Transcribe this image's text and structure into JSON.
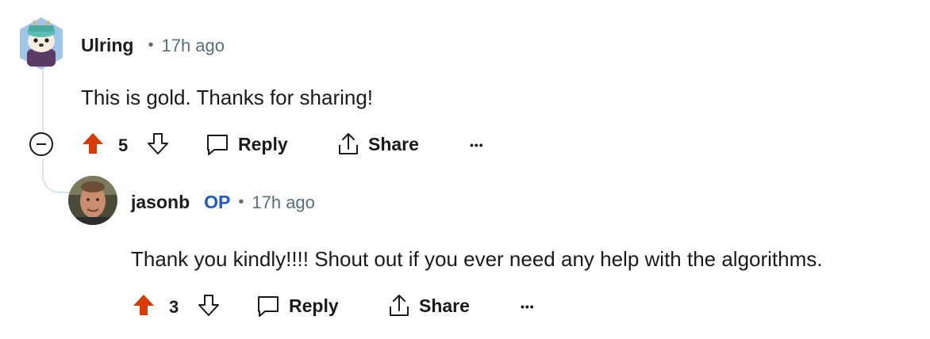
{
  "colors": {
    "upvote": "#d93a00",
    "op": "#1f59c8",
    "meta": "#576f76",
    "thread_line": "#d7e3ee"
  },
  "comments": [
    {
      "username": "Ulring",
      "separator": "•",
      "time": "17h ago",
      "body": "This is gold. Thanks for sharing!",
      "score": "5",
      "reply_label": "Reply",
      "share_label": "Share",
      "more_label": "•••"
    },
    {
      "username": "jasonb",
      "badge": "OP",
      "separator": "•",
      "time": "17h ago",
      "body": "Thank you kindly!!!! Shout out if you ever need any help with the algorithms.",
      "score": "3",
      "reply_label": "Reply",
      "share_label": "Share",
      "more_label": "•••"
    }
  ],
  "icons": {
    "avatar1": "otter-avatar-icon",
    "avatar2": "user-photo-avatar",
    "upvote": "upvote-arrow-icon",
    "downvote": "downvote-arrow-icon",
    "reply": "chat-bubble-icon",
    "share": "share-icon",
    "collapse": "collapse-minus-icon"
  }
}
